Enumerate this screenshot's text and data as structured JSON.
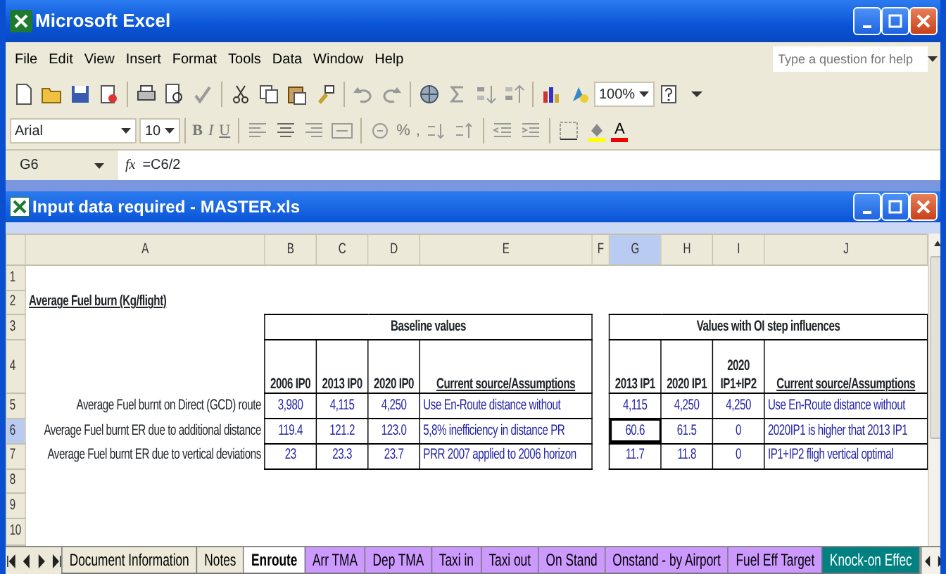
{
  "app": {
    "title": "Microsoft Excel"
  },
  "menu": [
    {
      "label": "File"
    },
    {
      "label": "Edit"
    },
    {
      "label": "View"
    },
    {
      "label": "Insert"
    },
    {
      "label": "Format"
    },
    {
      "label": "Tools"
    },
    {
      "label": "Data"
    },
    {
      "label": "Window"
    },
    {
      "label": "Help"
    }
  ],
  "help_box": {
    "placeholder": "Type a question for help"
  },
  "standard_toolbar": {
    "zoom": "100%"
  },
  "formatting_toolbar": {
    "font": "Arial",
    "size": "10",
    "style_buttons": [
      "B",
      "I",
      "U"
    ],
    "number_buttons": [
      "%",
      ","
    ],
    "font_color_button": "A"
  },
  "formula_bar": {
    "name_box": "G6",
    "fx": "fx",
    "formula": "=C6/2"
  },
  "workbook": {
    "title": "Input data required - MASTER.xls"
  },
  "columns": [
    {
      "label": "A",
      "selected": false
    },
    {
      "label": "B",
      "selected": false
    },
    {
      "label": "C",
      "selected": false
    },
    {
      "label": "D",
      "selected": false
    },
    {
      "label": "E",
      "selected": false
    },
    {
      "label": "F",
      "selected": false
    },
    {
      "label": "G",
      "selected": true
    },
    {
      "label": "H",
      "selected": false
    },
    {
      "label": "I",
      "selected": false
    },
    {
      "label": "J",
      "selected": false
    }
  ],
  "rows": [
    {
      "label": "1",
      "selected": false
    },
    {
      "label": "2",
      "selected": false
    },
    {
      "label": "3",
      "selected": false
    },
    {
      "label": "4",
      "selected": false
    },
    {
      "label": "5",
      "selected": false
    },
    {
      "label": "6",
      "selected": true
    },
    {
      "label": "7",
      "selected": false
    },
    {
      "label": "8",
      "selected": false
    },
    {
      "label": "9",
      "selected": false
    },
    {
      "label": "10",
      "selected": false
    }
  ],
  "sheet": {
    "heading": "Average Fuel burn (Kg/flight)",
    "baseline": {
      "title": "Baseline values",
      "headers": [
        "2006 IP0",
        "2013 IP0",
        "2020 IP0",
        "Current source/Assumptions"
      ]
    },
    "influences": {
      "title": "Values with OI step influences",
      "headers": [
        "2013 IP1",
        "2020 IP1",
        "2020 IP1+IP2",
        "Current source/Assumptions"
      ]
    },
    "data_rows": [
      {
        "label": "Average Fuel burnt on Direct (GCD) route",
        "baseline": [
          "3,980",
          "4,115",
          "4,250",
          "Use En-Route distance without"
        ],
        "influences": [
          "4,115",
          "4,250",
          "4,250",
          "Use En-Route distance without"
        ]
      },
      {
        "label": "Average Fuel burnt ER due to additional distance",
        "baseline": [
          "119.4",
          "121.2",
          "123.0",
          "5,8% inefficiency in distance PR"
        ],
        "influences": [
          "60.6",
          "61.5",
          "0",
          "2020IP1 is higher that 2013 IP1"
        ]
      },
      {
        "label": "Average Fuel burnt ER due to vertical deviations",
        "baseline": [
          "23",
          "23.3",
          "23.7",
          "PRR 2007 applied to 2006 horizon"
        ],
        "influences": [
          "11.7",
          "11.8",
          "0",
          "IP1+IP2 fligh vertical optimal"
        ]
      }
    ]
  },
  "sheet_tabs": [
    {
      "label": "Document Information",
      "selected": false
    },
    {
      "label": "Notes",
      "selected": false
    },
    {
      "label": "Enroute",
      "selected": true
    },
    {
      "label": "Arr TMA",
      "selected": false,
      "color": "#cc99ff"
    },
    {
      "label": "Dep TMA",
      "selected": false,
      "color": "#cc99ff"
    },
    {
      "label": "Taxi in",
      "selected": false,
      "color": "#cc99ff"
    },
    {
      "label": "Taxi out",
      "selected": false,
      "color": "#cc99ff"
    },
    {
      "label": "On Stand",
      "selected": false,
      "color": "#cc99ff"
    },
    {
      "label": "Onstand - by Airport",
      "selected": false,
      "color": "#cc99ff"
    },
    {
      "label": "Fuel Eff Target",
      "selected": false,
      "color": "#cc99ff"
    },
    {
      "label": "Knock-on Effec",
      "selected": false,
      "color": "#008080"
    }
  ]
}
